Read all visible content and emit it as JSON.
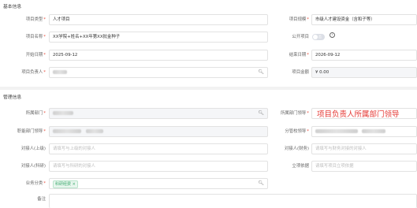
{
  "sections": {
    "basic": "基本信息",
    "management": "管理信息"
  },
  "basic": {
    "project_type": {
      "label": "项目类型",
      "value": "人才项目"
    },
    "project_scale": {
      "label": "项目规模",
      "value": "市级人才建设资金（含和子等）"
    },
    "project_name": {
      "label": "项目名称",
      "value": "XX学院+姓名+XX年第XX批金种子"
    },
    "public_project": {
      "label": "公开项目",
      "toggle_text": "否"
    },
    "start_date": {
      "label": "开始日期",
      "value": "2025-09-12"
    },
    "end_date": {
      "label": "结束日期",
      "value": "2026-09-12"
    },
    "project_lead": {
      "label": "项目负责人"
    },
    "project_amount": {
      "label": "项目金额",
      "value": "¥ 0.00"
    }
  },
  "management": {
    "department": {
      "label": "所属部门"
    },
    "department_leader": {
      "label": "所属部门领导",
      "annotation": "项目负责人所属部门领导"
    },
    "functional_leader": {
      "label": "职能部门领导"
    },
    "supervising_leader": {
      "label": "分管校领导"
    },
    "handler_upper": {
      "label": "对接人(上级)",
      "placeholder": "请填写与上级的对接人"
    },
    "handler_finance": {
      "label": "对接人(财务)",
      "placeholder": "请填写与财务对接的对接人"
    },
    "handler_research": {
      "label": "对接人(科研)",
      "placeholder": "请填写与科研的对接人"
    },
    "approval_basis": {
      "label": "立项依据",
      "placeholder": "请填写项目立项依据"
    },
    "business_category": {
      "label": "业务分类",
      "tag": "科研经费"
    },
    "remarks": {
      "label": "备注"
    }
  },
  "icons": {
    "search": "magnifier",
    "info": "info-circle",
    "tag_close": "×"
  }
}
